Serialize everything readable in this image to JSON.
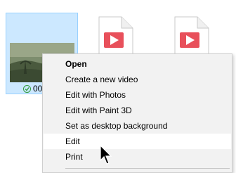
{
  "files": [
    {
      "name": "00",
      "selected": true,
      "status_icon": "sync-check-icon",
      "thumbnail": "landscape-thumbnail"
    },
    {
      "icon": "video-file-icon"
    },
    {
      "icon": "video-file-icon"
    }
  ],
  "context_menu": {
    "items": [
      {
        "label": "Open",
        "default": true
      },
      {
        "label": "Create a new video"
      },
      {
        "label": "Edit with Photos"
      },
      {
        "label": "Edit with Paint 3D"
      },
      {
        "label": "Set as desktop background"
      },
      {
        "label": "Edit",
        "hovered": true
      },
      {
        "label": "Print"
      }
    ]
  },
  "colors": {
    "selection_bg": "#cce8ff",
    "selection_border": "#99d1ff",
    "menu_bg": "#f2f2f2",
    "menu_hover": "#ffffff",
    "video_accent": "#e8505b"
  },
  "cursor": "arrow-cursor-icon"
}
